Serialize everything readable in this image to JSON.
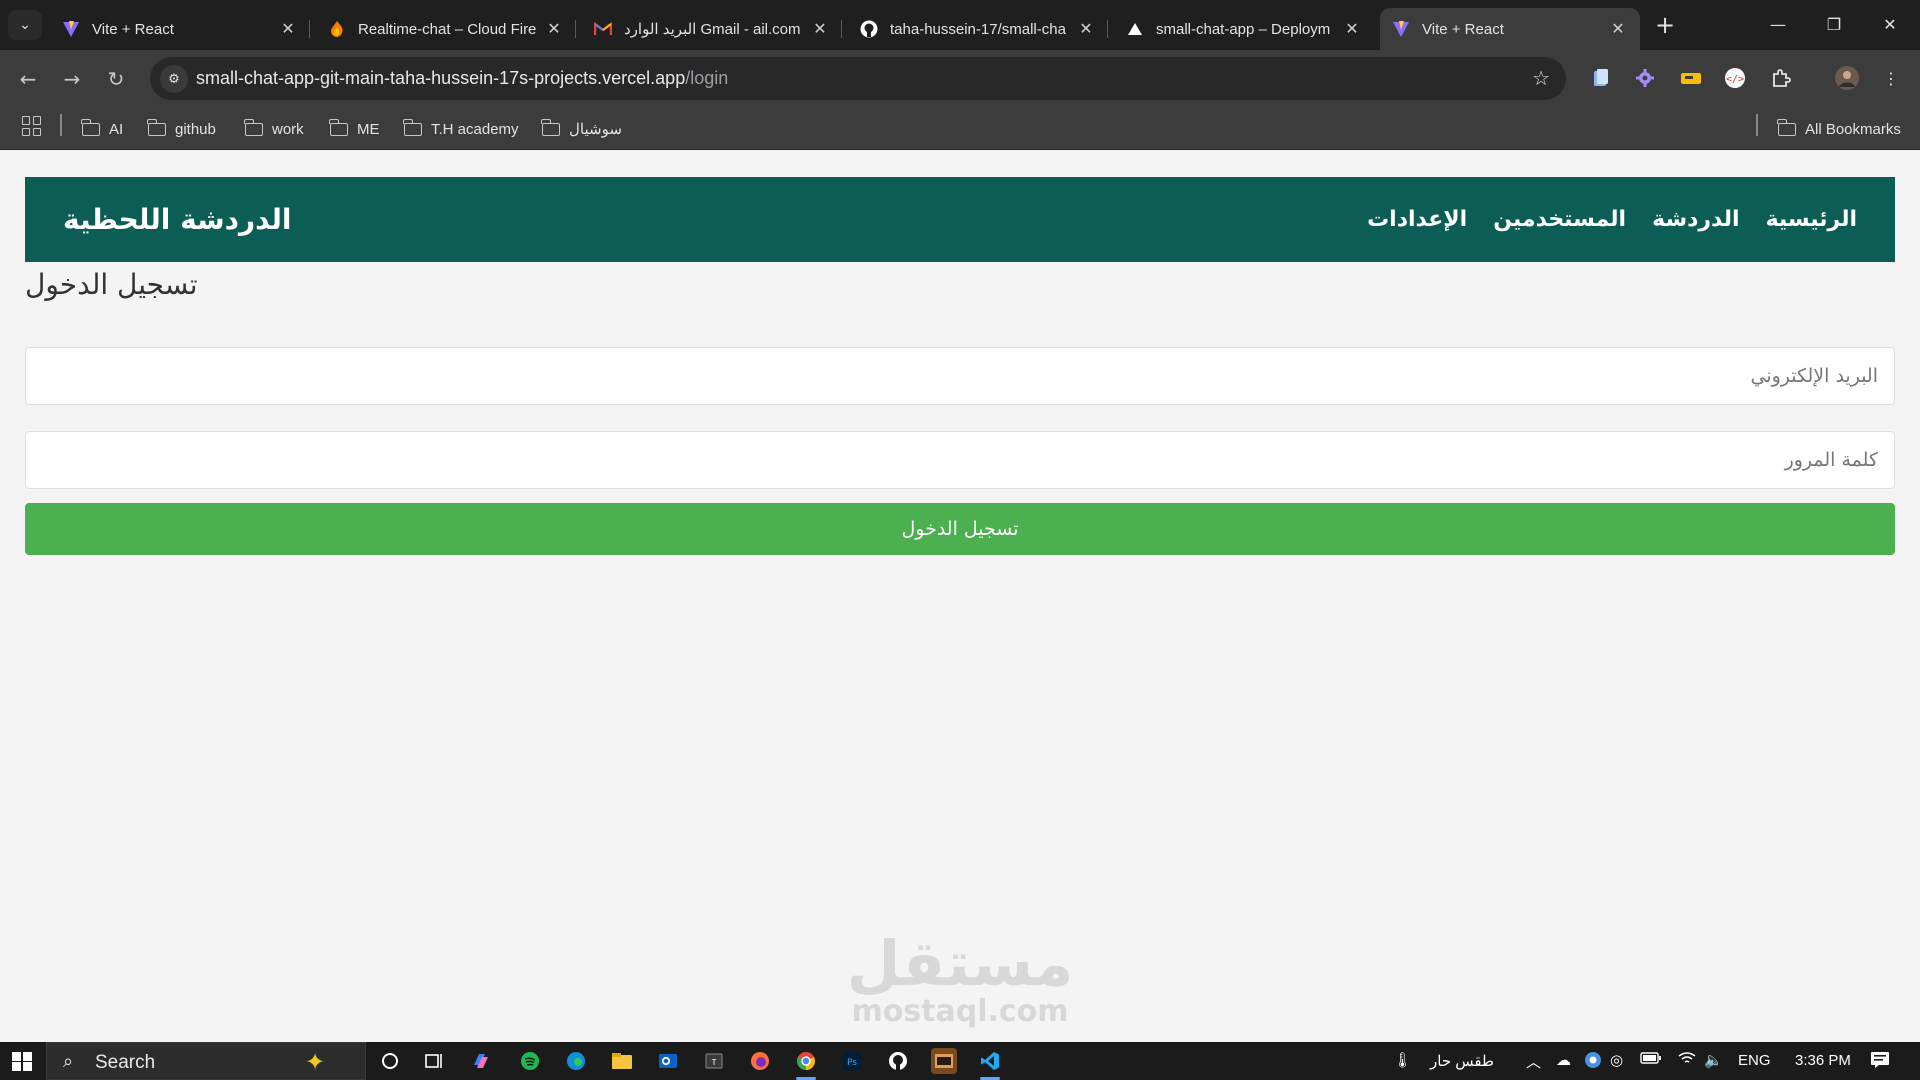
{
  "browser": {
    "tabs": [
      {
        "title": "Vite + React",
        "icon": "vite-icon"
      },
      {
        "title": "Realtime-chat – Cloud Fire",
        "icon": "firebase-icon"
      },
      {
        "title": "البريد الوارد Gmail - ail.com",
        "icon": "gmail-icon"
      },
      {
        "title": "taha-hussein-17/small-cha",
        "icon": "github-icon"
      },
      {
        "title": "small-chat-app – Deploym",
        "icon": "vercel-icon"
      },
      {
        "title": "Vite + React",
        "icon": "vite-icon"
      }
    ],
    "active_tab": 5,
    "url_host": "small-chat-app-git-main-taha-hussein-17s-projects.vercel.app",
    "url_path": "/login",
    "bookmarks": [
      "AI",
      "github",
      "work",
      "ME",
      "T.H academy",
      "سوشيال"
    ],
    "all_bookmarks": "All Bookmarks"
  },
  "app": {
    "brand": "الدردشة اللحظية",
    "nav": [
      "الرئيسية",
      "الدردشة",
      "المستخدمين",
      "الإعدادات"
    ],
    "login_title": "تسجيل الدخول",
    "email_placeholder": "البريد الإلكتروني",
    "password_placeholder": "كلمة المرور",
    "submit_label": "تسجيل الدخول",
    "colors": {
      "header": "#0b5d56",
      "button": "#4caf50",
      "background": "#f4f4f4"
    }
  },
  "watermark": {
    "arabic": "مستقل",
    "latin": "mostaql.com"
  },
  "taskbar": {
    "search_label": "Search",
    "weather": "طقس حار",
    "language": "ENG",
    "time": "3:36 PM"
  }
}
